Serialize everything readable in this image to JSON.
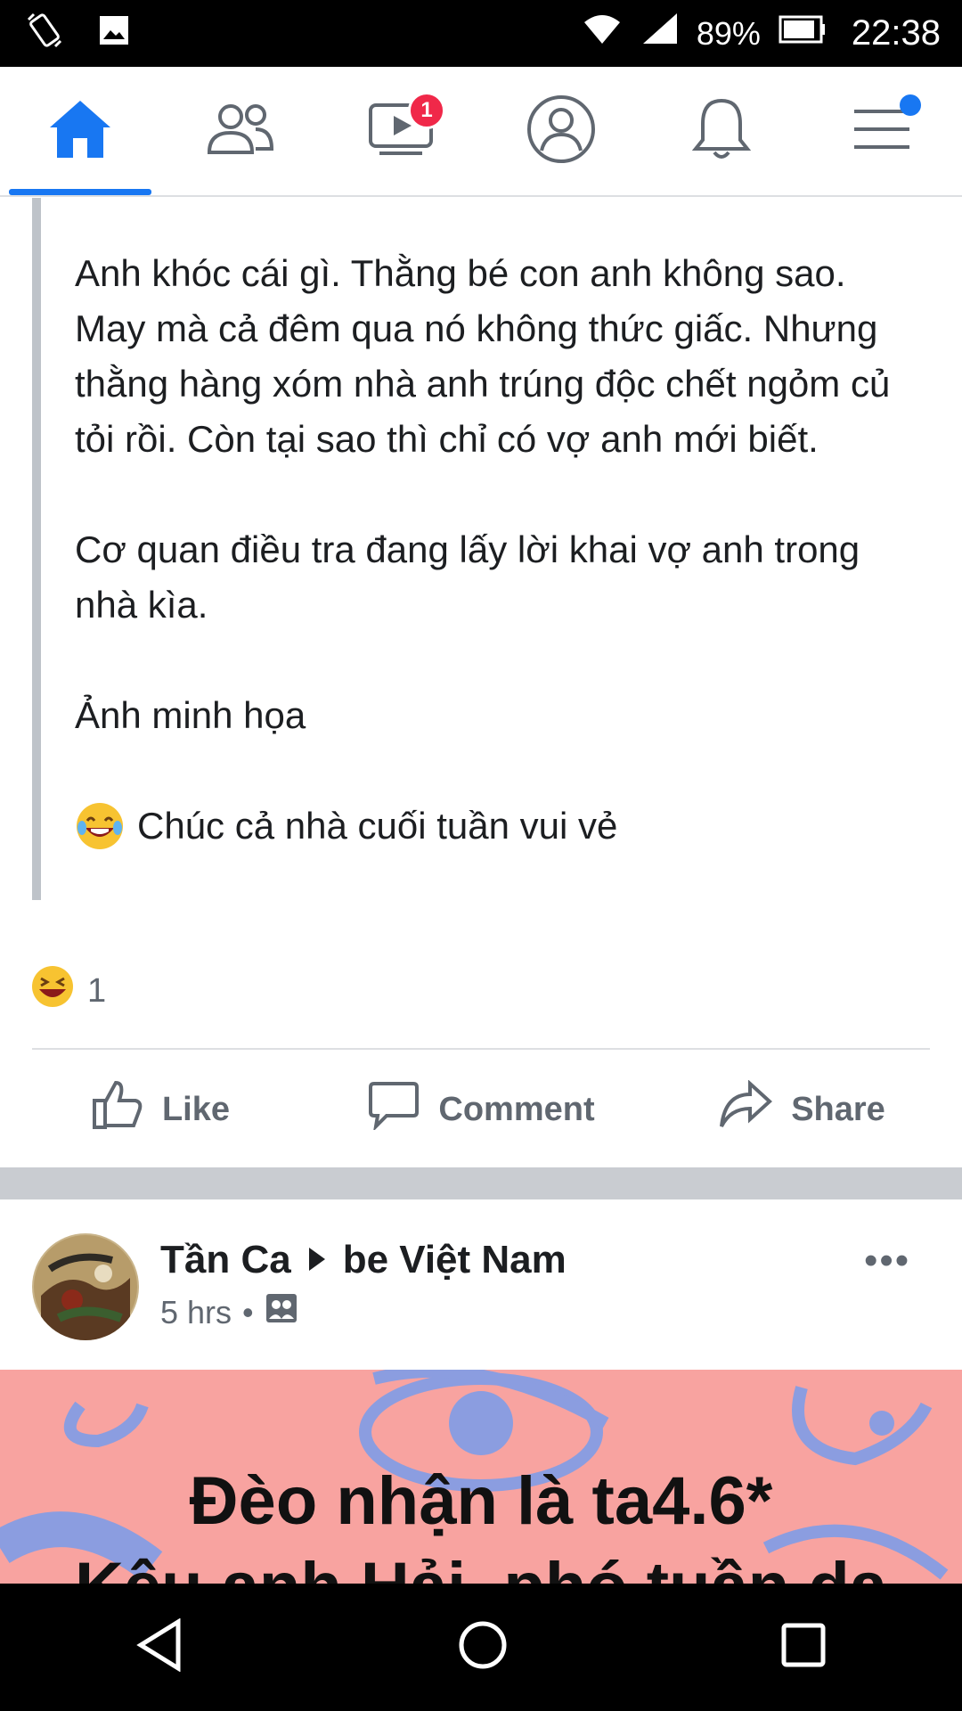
{
  "status_bar": {
    "battery_percent": "89%",
    "time": "22:38"
  },
  "nav": {
    "video_badge": "1",
    "items": [
      "home",
      "friends",
      "watch",
      "profile",
      "notifications",
      "menu"
    ]
  },
  "post1": {
    "paragraphs": [
      "Anh khóc cái gì. Thằng bé con anh không sao. May mà cả đêm qua nó không thức giấc. Nhưng thằng hàng xóm nhà anh trúng độc chết ngỏm củ tỏi rồi. Còn tại sao thì chỉ có vợ anh mới biết.",
      "Cơ quan điều tra đang lấy lời khai vợ anh trong nhà kìa.",
      "Ảnh minh họa",
      "Chúc cả nhà cuối tuần vui vẻ"
    ],
    "reaction_count": "1",
    "actions": {
      "like": "Like",
      "comment": "Comment",
      "share": "Share"
    }
  },
  "post2": {
    "author": "Tần Ca",
    "group": "be Việt Nam",
    "time": "5 hrs",
    "more": "•••",
    "banner_lines": [
      "Đèo nhận là ta4.6*",
      "Kêu anh Hải, phó tuần da"
    ]
  },
  "colors": {
    "accent": "#1877f2",
    "badge": "#f02849",
    "banner_bg": "#f8a3a0",
    "banner_pattern": "#8b9de0"
  }
}
